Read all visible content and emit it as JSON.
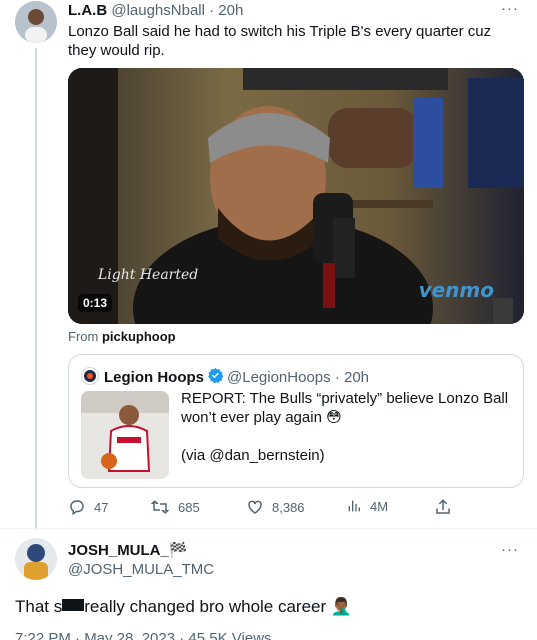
{
  "tweet": {
    "author_name": "L.A.B",
    "author_handle": "@laughsNball",
    "time": "· 20h",
    "more": "···",
    "text": "Lonzo Ball said he had to switch his Triple B's every quarter cuz they would rip.",
    "video": {
      "duration": "0:13",
      "overlay_brand": "venmo",
      "overlay_logo": "Light Hearted"
    },
    "from_label": "From",
    "from_source": "pickuphoop",
    "quote": {
      "author_name": "Legion Hoops",
      "author_handle": "@LegionHoops",
      "time": "· 20h",
      "text": "REPORT: The Bulls “privately” believe Lonzo Ball won’t ever play again 😳",
      "via": "(via @dan_bernstein)"
    },
    "actions": {
      "replies": "47",
      "retweets": "685",
      "likes": "8,386",
      "views": "4M"
    },
    "colors": {
      "accent": "#1d9bf0",
      "muted": "#536471",
      "border": "#cfd9de"
    }
  },
  "reply": {
    "author_name": "JOSH_MULA_",
    "author_flag": "🏁",
    "author_handle": "@JOSH_MULA_TMC",
    "more": "···",
    "text_before": "That s",
    "text_after": "really changed bro whole career 🤦🏾‍♂️",
    "footer": "7:22 PM · May 28, 2023 · 45.5K Views"
  }
}
